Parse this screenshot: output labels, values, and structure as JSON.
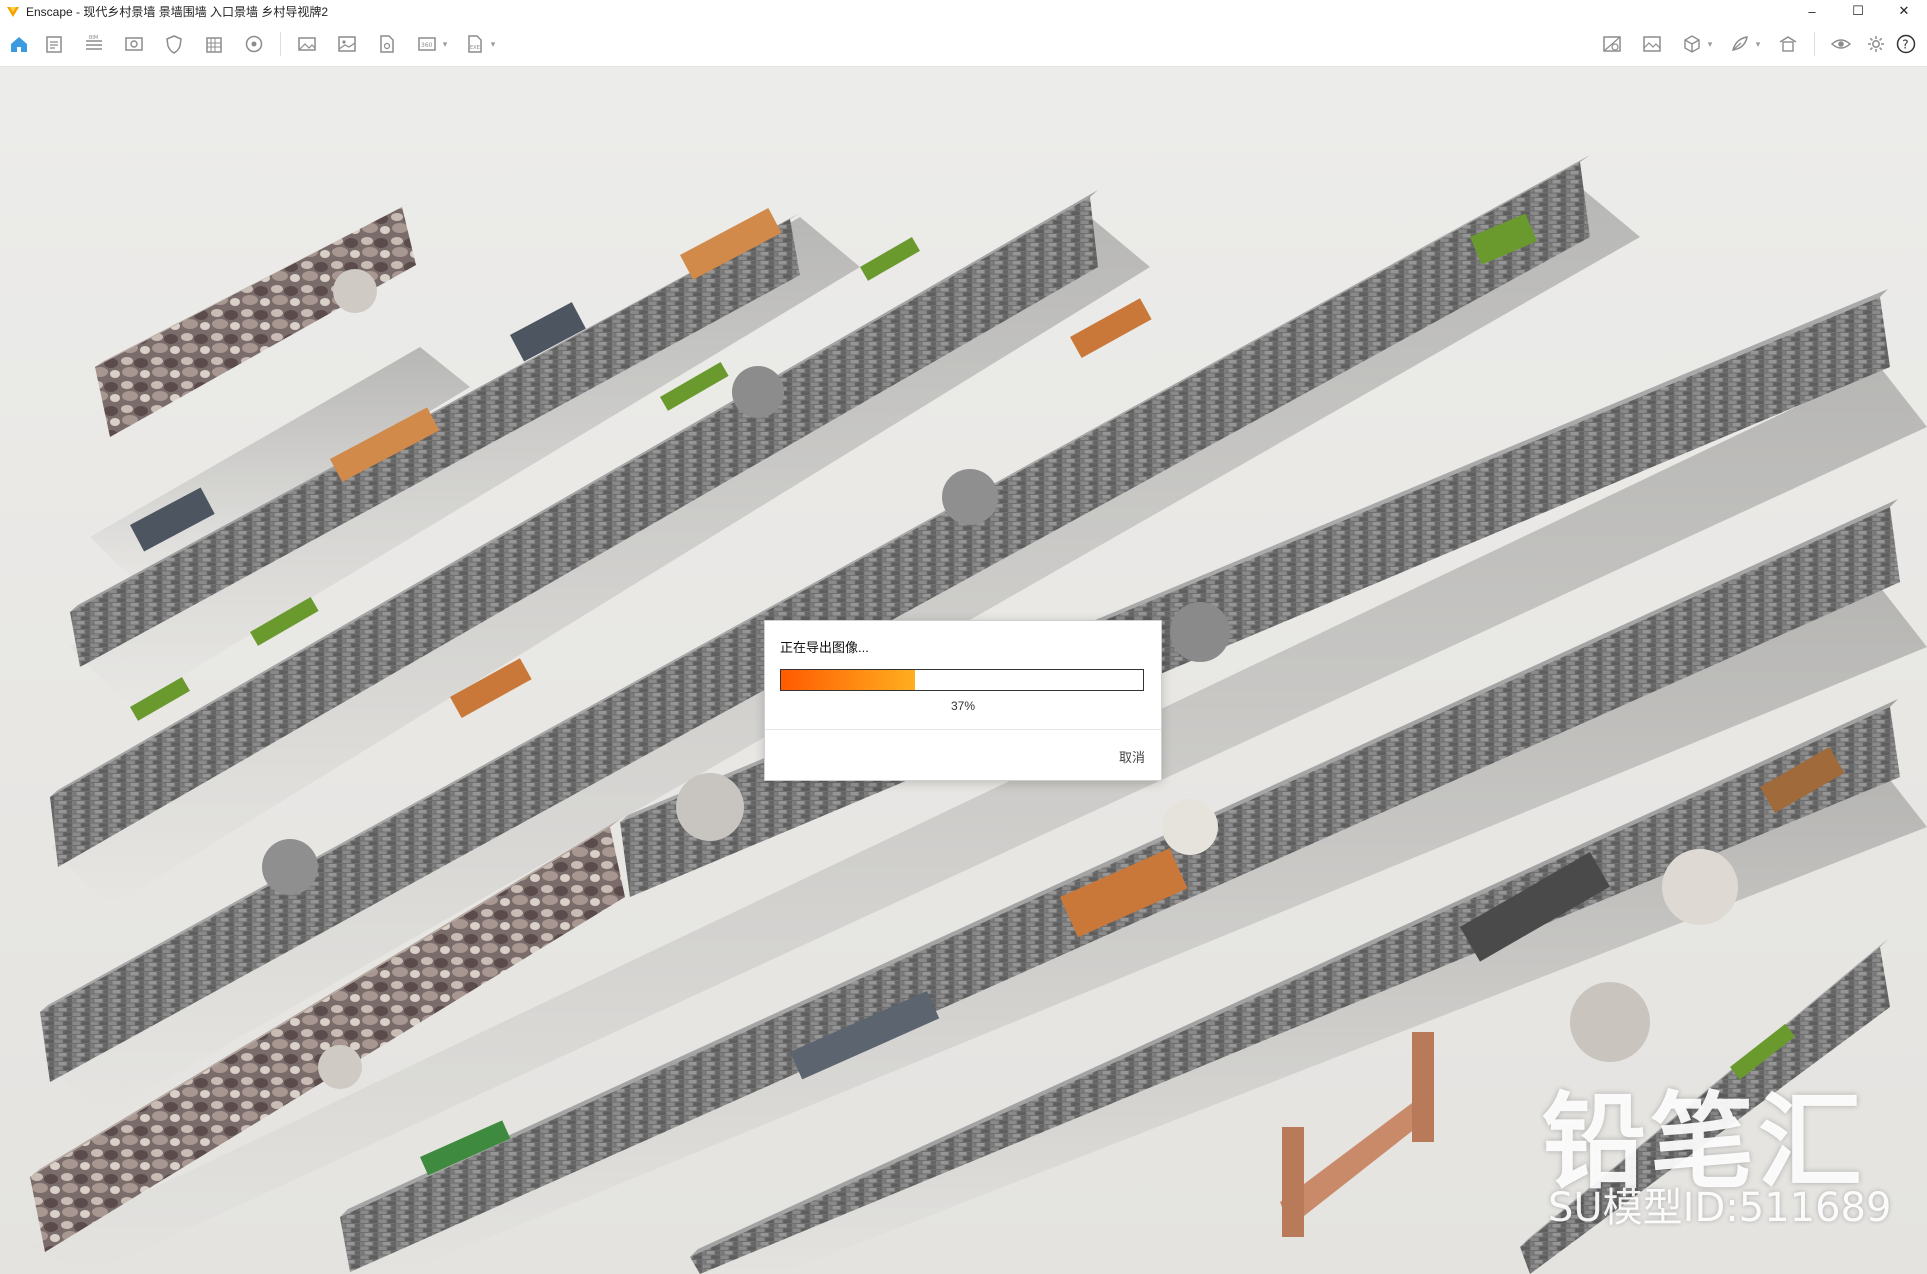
{
  "window": {
    "title": "Enscape - 现代乡村景墙 景墙围墙 入口景墙 乡村导视牌2",
    "controls": {
      "minimize": "–",
      "maximize": "☐",
      "close": "✕"
    }
  },
  "toolbar": {
    "left_icons": [
      "home-icon",
      "notes-icon",
      "bim-icon",
      "views-icon",
      "shield-icon",
      "building-icon",
      "camera-path-icon",
      "screenshot-icon",
      "image-export-icon",
      "export-file-icon",
      "exe-export-icon",
      "web-export-icon"
    ],
    "right_icons": [
      "asset-library-icon",
      "image-settings-icon",
      "cube-icon",
      "material-editor-icon",
      "collaborate-icon",
      "visibility-icon",
      "settings-icon",
      "help-icon"
    ],
    "help_label": "?"
  },
  "dialog": {
    "title": "正在导出图像...",
    "progress": 0.37,
    "progress_text": "37%",
    "cancel_label": "取消"
  },
  "watermark": {
    "brand": "铅笔汇",
    "model_id": "SU模型ID:511689"
  },
  "colors": {
    "accent": "#ff7a0a",
    "app_logo": "#f5a300",
    "ground": "#e8e7e4",
    "brick": "#6f6f6f",
    "wood": "#c9783a",
    "moss": "#6a9a2e"
  }
}
